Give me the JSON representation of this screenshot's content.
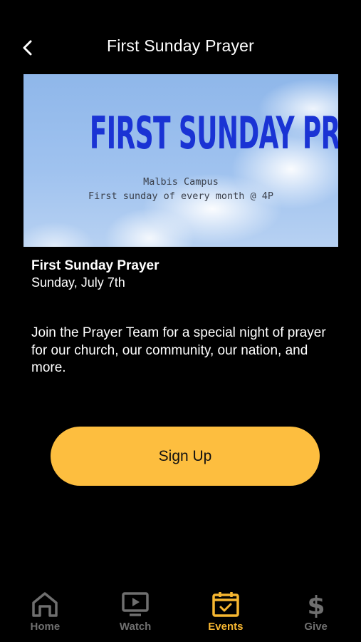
{
  "header": {
    "title": "First Sunday Prayer",
    "back_icon": "chevron-left-icon"
  },
  "banner": {
    "heading": "FIRST SUNDAY PRAYER",
    "line1": "Malbis Campus",
    "line2": "First sunday of every month @ 4P"
  },
  "event": {
    "title": "First Sunday Prayer",
    "date": "Sunday, July 7th",
    "description": "Join the Prayer Team for a special night of prayer for our church, our community, our nation, and more."
  },
  "signup_label": "Sign Up",
  "tabs": [
    {
      "label": "Home",
      "icon": "home-icon",
      "active": false
    },
    {
      "label": "Watch",
      "icon": "play-icon",
      "active": false
    },
    {
      "label": "Events",
      "icon": "calendar-icon",
      "active": true
    },
    {
      "label": "Give",
      "icon": "dollar-icon",
      "active": false
    }
  ],
  "colors": {
    "accent": "#fdbe3f",
    "active_tab": "#f7b731",
    "inactive_tab": "#6f6f6f",
    "banner_text": "#1a33d4"
  }
}
